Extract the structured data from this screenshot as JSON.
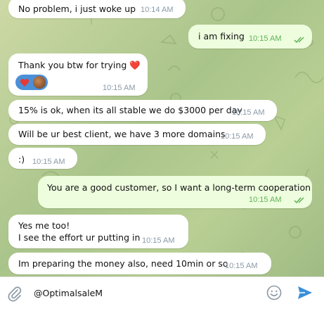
{
  "messages": [
    {
      "direction": "in",
      "lines": [
        "No problem, i just woke up"
      ],
      "time": "10:14 AM"
    },
    {
      "direction": "out",
      "lines": [
        "i am fixing"
      ],
      "time": "10:15 AM",
      "read": true
    },
    {
      "direction": "in",
      "lines": [
        "Thank you btw for trying ❤️"
      ],
      "time": "10:15 AM",
      "reactions": [
        "heart",
        "avatar"
      ]
    },
    {
      "direction": "in",
      "lines": [
        "15% is ok, when its all stable we do $3000 per day"
      ],
      "time": "10:15 AM"
    },
    {
      "direction": "in",
      "lines": [
        "Will be ur best client, we have 3 more domains"
      ],
      "time": "10:15 AM"
    },
    {
      "direction": "in",
      "lines": [
        ":)"
      ],
      "time": "10:15 AM"
    },
    {
      "direction": "out",
      "lines": [
        "You are a good customer, so I want a long-term cooperation"
      ],
      "time": "10:15 AM",
      "read": true
    },
    {
      "direction": "in",
      "lines": [
        "Yes me too!",
        "I see the effort ur putting in"
      ],
      "time": "10:15 AM"
    },
    {
      "direction": "in",
      "lines": [
        "Im preparing the money also, need 10min or so"
      ],
      "time": "10:15 AM"
    }
  ],
  "composer": {
    "text": "@OptimalsaleM",
    "attach_icon": "paperclip-icon",
    "emoji_icon": "smiley-icon",
    "send_icon": "send-icon"
  },
  "colors": {
    "incoming_bubble": "#ffffff",
    "outgoing_bubble": "#eefdde",
    "outgoing_time": "#5fb158",
    "incoming_time": "#8a9aa6",
    "send": "#3a8fd9",
    "reaction_pill": "#4a90d9",
    "heart": "#e53935"
  }
}
